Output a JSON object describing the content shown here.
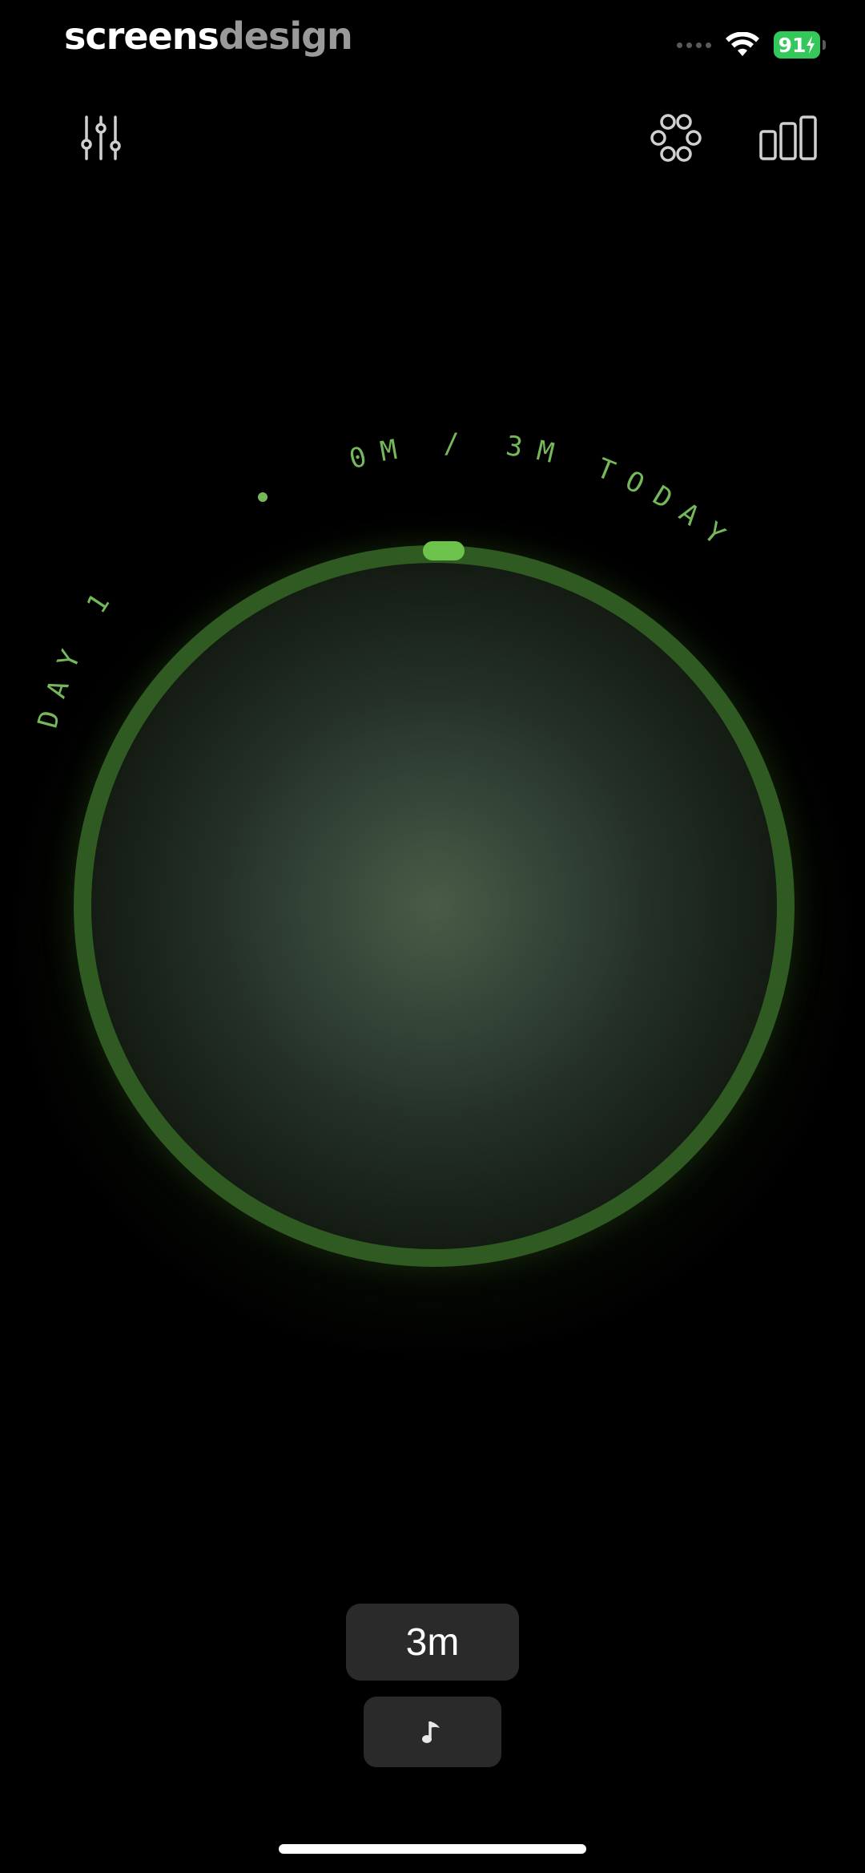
{
  "watermark": {
    "part1": "screens",
    "part2": "design"
  },
  "status_bar": {
    "battery": "91",
    "wifi_icon": "wifi-icon",
    "signal_icon": "signal-dots-icon"
  },
  "toolbar": {
    "left_icon": "sliders-icon",
    "right_icons": [
      "breath-flower-icon",
      "bar-chart-icon"
    ]
  },
  "timer": {
    "day_label": "DAY 1",
    "progress_label": "0M / 3M TODAY",
    "progress_fraction": 0,
    "accent_color": "#6cc24a",
    "ring_color": "#2f5a22"
  },
  "controls": {
    "duration": "3m",
    "sound_icon": "music-note-icon"
  }
}
